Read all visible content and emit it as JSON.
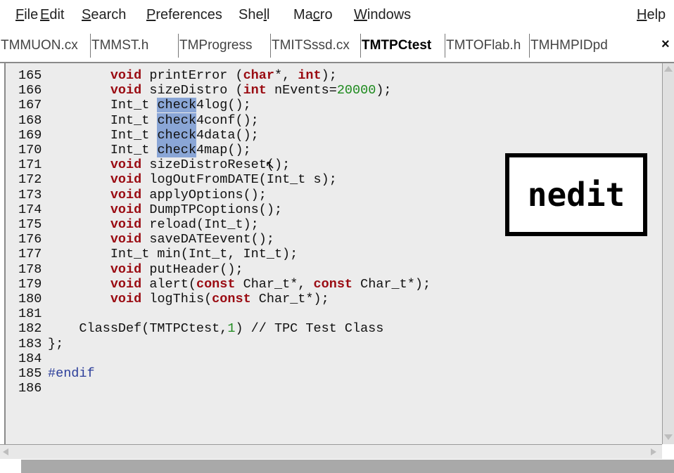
{
  "menu": {
    "items": [
      {
        "pre": "",
        "ul": "F",
        "post": "ile"
      },
      {
        "pre": "",
        "ul": "E",
        "post": "dit"
      },
      {
        "pre": "",
        "ul": "S",
        "post": "earch"
      },
      {
        "pre": "",
        "ul": "P",
        "post": "references"
      },
      {
        "pre": "She",
        "ul": "l",
        "post": "l"
      },
      {
        "pre": "Ma",
        "ul": "c",
        "post": "ro"
      },
      {
        "pre": "",
        "ul": "W",
        "post": "indows"
      },
      {
        "pre": "",
        "ul": "H",
        "post": "elp"
      }
    ]
  },
  "tabs": [
    {
      "label": "TMMUON.cx"
    },
    {
      "label": "TMMST.h"
    },
    {
      "label": "TMProgress"
    },
    {
      "label": "TMITSssd.cx"
    },
    {
      "label": "TMTPCtest",
      "active": true
    },
    {
      "label": "TMTOFlab.h"
    },
    {
      "label": "TMHMPIDpd"
    }
  ],
  "tab_close": "×",
  "code_lines": [
    {
      "n": "165",
      "parts": [
        [
          "",
          "        "
        ],
        [
          "kw",
          "void"
        ],
        [
          "",
          " printError ("
        ],
        [
          "kw",
          "char"
        ],
        [
          "",
          "*, "
        ],
        [
          "kw",
          "int"
        ],
        [
          "",
          ");"
        ]
      ]
    },
    {
      "n": "166",
      "parts": [
        [
          "",
          "        "
        ],
        [
          "kw",
          "void"
        ],
        [
          "",
          " sizeDistro ("
        ],
        [
          "kw",
          "int"
        ],
        [
          "",
          " nEvents="
        ],
        [
          "num",
          "20000"
        ],
        [
          "",
          ");"
        ]
      ]
    },
    {
      "n": "167",
      "parts": [
        [
          "",
          "        Int_t "
        ],
        [
          "hl",
          "check"
        ],
        [
          "",
          "4log();"
        ]
      ]
    },
    {
      "n": "168",
      "parts": [
        [
          "",
          "        Int_t "
        ],
        [
          "hl",
          "check"
        ],
        [
          "",
          "4conf();"
        ]
      ]
    },
    {
      "n": "169",
      "parts": [
        [
          "",
          "        Int_t "
        ],
        [
          "hl",
          "check"
        ],
        [
          "",
          "4data();"
        ]
      ]
    },
    {
      "n": "170",
      "parts": [
        [
          "",
          "        Int_t "
        ],
        [
          "hl",
          "check"
        ],
        [
          "",
          "4map();"
        ]
      ]
    },
    {
      "n": "171",
      "parts": [
        [
          "",
          "        "
        ],
        [
          "kw",
          "void"
        ],
        [
          "",
          " sizeDistroReset();"
        ]
      ]
    },
    {
      "n": "172",
      "parts": [
        [
          "",
          "        "
        ],
        [
          "kw",
          "void"
        ],
        [
          "",
          " logOutFromDATE(Int_t s);"
        ]
      ]
    },
    {
      "n": "173",
      "parts": [
        [
          "",
          "        "
        ],
        [
          "kw",
          "void"
        ],
        [
          "",
          " applyOptions();"
        ]
      ]
    },
    {
      "n": "174",
      "parts": [
        [
          "",
          "        "
        ],
        [
          "kw",
          "void"
        ],
        [
          "",
          " DumpTPCoptions();"
        ]
      ]
    },
    {
      "n": "175",
      "parts": [
        [
          "",
          "        "
        ],
        [
          "kw",
          "void"
        ],
        [
          "",
          " reload(Int_t);"
        ]
      ]
    },
    {
      "n": "176",
      "parts": [
        [
          "",
          "        "
        ],
        [
          "kw",
          "void"
        ],
        [
          "",
          " saveDATEevent();"
        ]
      ]
    },
    {
      "n": "177",
      "parts": [
        [
          "",
          "        Int_t min(Int_t, Int_t);"
        ]
      ]
    },
    {
      "n": "178",
      "parts": [
        [
          "",
          "        "
        ],
        [
          "kw",
          "void"
        ],
        [
          "",
          " putHeader();"
        ]
      ]
    },
    {
      "n": "179",
      "parts": [
        [
          "",
          "        "
        ],
        [
          "kw",
          "void"
        ],
        [
          "",
          " alert("
        ],
        [
          "kw",
          "const"
        ],
        [
          "",
          " Char_t*, "
        ],
        [
          "kw",
          "const"
        ],
        [
          "",
          " Char_t*);"
        ]
      ]
    },
    {
      "n": "180",
      "parts": [
        [
          "",
          "        "
        ],
        [
          "kw",
          "void"
        ],
        [
          "",
          " logThis("
        ],
        [
          "kw",
          "const"
        ],
        [
          "",
          " Char_t*);"
        ]
      ]
    },
    {
      "n": "181",
      "parts": []
    },
    {
      "n": "182",
      "parts": [
        [
          "",
          "    ClassDef(TMTPCtest,"
        ],
        [
          "num",
          "1"
        ],
        [
          "",
          ") // TPC Test Class"
        ]
      ]
    },
    {
      "n": "183",
      "parts": [
        [
          "",
          "};"
        ]
      ]
    },
    {
      "n": "184",
      "parts": []
    },
    {
      "n": "185",
      "parts": [
        [
          "pp",
          "#endif"
        ]
      ]
    },
    {
      "n": "186",
      "parts": []
    }
  ],
  "overlay_label": "nedit",
  "colors": {
    "keyword": "#9a0b12",
    "number": "#1d8a1d",
    "preprocessor": "#2c3e9a",
    "selection": "#8aa6d6",
    "editor_bg": "#ececec"
  }
}
